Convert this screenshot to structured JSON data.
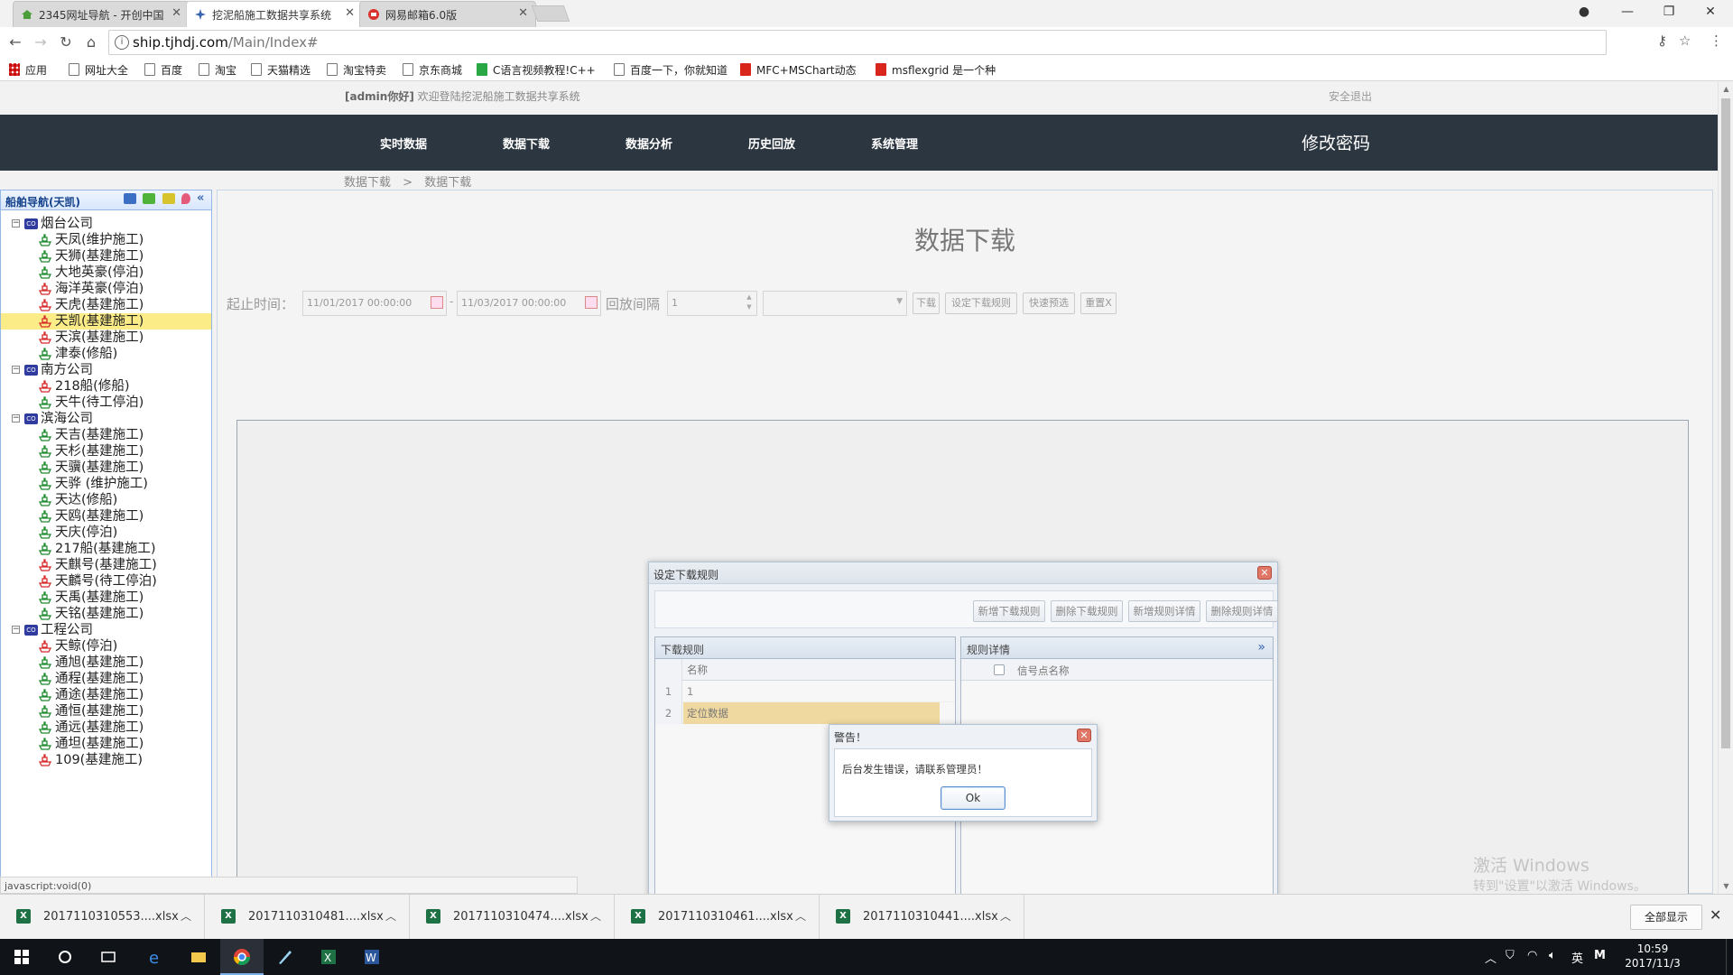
{
  "browser": {
    "tabs": [
      {
        "label": "2345网址导航 - 开创中国",
        "active": false
      },
      {
        "label": "挖泥船施工数据共享系统",
        "active": true
      },
      {
        "label": "网易邮箱6.0版",
        "active": false
      }
    ],
    "url_host": "ship.tjhdj.com",
    "url_path": "/Main/Index#",
    "bookmarks": [
      "应用",
      "网址大全",
      "百度",
      "淘宝",
      "天猫精选",
      "淘宝特卖",
      "京东商城",
      "C语言视频教程!C++",
      "百度一下，你就知道",
      "MFC+MSChart动态",
      "msflexgrid 是一个种"
    ]
  },
  "header": {
    "user": "[admin你好]",
    "welcome": "欢迎登陆挖泥船施工数据共享系统",
    "logout": "安全退出",
    "nav": [
      "实时数据",
      "数据下载",
      "数据分析",
      "历史回放",
      "系统管理"
    ],
    "change_password": "修改密码"
  },
  "breadcrumb": {
    "parent": "数据下载",
    "sep": ">",
    "current": "数据下载"
  },
  "left_panel": {
    "title": "船舶导航(天凯)",
    "tree": [
      {
        "type": "company",
        "label": "烟台公司"
      },
      {
        "type": "ship",
        "label": "天凤(维护施工)",
        "status": "green"
      },
      {
        "type": "ship",
        "label": "天狮(基建施工)",
        "status": "green"
      },
      {
        "type": "ship",
        "label": "大地英豪(停泊)",
        "status": "green"
      },
      {
        "type": "ship",
        "label": "海洋英豪(停泊)",
        "status": "red"
      },
      {
        "type": "ship",
        "label": "天虎(基建施工)",
        "status": "red"
      },
      {
        "type": "ship",
        "label": "天凯(基建施工)",
        "status": "red",
        "selected": true
      },
      {
        "type": "ship",
        "label": "天滨(基建施工)",
        "status": "red"
      },
      {
        "type": "ship",
        "label": "津泰(修船)",
        "status": "green"
      },
      {
        "type": "company",
        "label": "南方公司"
      },
      {
        "type": "ship",
        "label": "218船(修船)",
        "status": "red"
      },
      {
        "type": "ship",
        "label": "天牛(待工停泊)",
        "status": "green"
      },
      {
        "type": "company",
        "label": "滨海公司"
      },
      {
        "type": "ship",
        "label": "天吉(基建施工)",
        "status": "green"
      },
      {
        "type": "ship",
        "label": "天杉(基建施工)",
        "status": "green"
      },
      {
        "type": "ship",
        "label": "天骥(基建施工)",
        "status": "green"
      },
      {
        "type": "ship",
        "label": "天骅 (维护施工)",
        "status": "green"
      },
      {
        "type": "ship",
        "label": "天达(修船)",
        "status": "green"
      },
      {
        "type": "ship",
        "label": "天鸥(基建施工)",
        "status": "green"
      },
      {
        "type": "ship",
        "label": "天庆(停泊)",
        "status": "green"
      },
      {
        "type": "ship",
        "label": "217船(基建施工)",
        "status": "green"
      },
      {
        "type": "ship",
        "label": "天麒号(基建施工)",
        "status": "red"
      },
      {
        "type": "ship",
        "label": "天麟号(待工停泊)",
        "status": "red"
      },
      {
        "type": "ship",
        "label": "天禹(基建施工)",
        "status": "green"
      },
      {
        "type": "ship",
        "label": "天铭(基建施工)",
        "status": "green"
      },
      {
        "type": "company",
        "label": "工程公司"
      },
      {
        "type": "ship",
        "label": "天鲸(停泊)",
        "status": "red"
      },
      {
        "type": "ship",
        "label": "通旭(基建施工)",
        "status": "green"
      },
      {
        "type": "ship",
        "label": "通程(基建施工)",
        "status": "green"
      },
      {
        "type": "ship",
        "label": "通途(基建施工)",
        "status": "green"
      },
      {
        "type": "ship",
        "label": "通恒(基建施工)",
        "status": "green"
      },
      {
        "type": "ship",
        "label": "通远(基建施工)",
        "status": "green"
      },
      {
        "type": "ship",
        "label": "通坦(基建施工)",
        "status": "green"
      },
      {
        "type": "ship",
        "label": "109(基建施工)",
        "status": "red"
      }
    ]
  },
  "content": {
    "title": "数据下载",
    "filter": {
      "start_label": "起止时间：",
      "start_value": "11/01/2017 00:00:00",
      "dash": "-",
      "end_value": "11/03/2017 00:00:00",
      "interval_label": "回放间隔",
      "interval_value": "1",
      "buttons": [
        "下载",
        "设定下载规则",
        "快速预选",
        "重置X"
      ]
    }
  },
  "dialog": {
    "title": "设定下载规则",
    "toolbar": [
      "新增下载规则",
      "删除下载规则",
      "新增规则详情",
      "删除规则详情"
    ],
    "left_pane": {
      "title": "下载规则",
      "col": "名称",
      "rows": [
        {
          "n": "1",
          "name": "1"
        },
        {
          "n": "2",
          "name": "定位数据"
        }
      ]
    },
    "right_pane": {
      "title": "规则详情",
      "col": "信号点名称",
      "collapse": "»"
    }
  },
  "alert": {
    "title": "警告！",
    "message": "后台发生错误，请联系管理员！",
    "ok": "Ok"
  },
  "statusbar": "javascript:void(0)",
  "watermark": {
    "line1": "激活 Windows",
    "line2": "转到\"设置\"以激活 Windows。"
  },
  "downloads": {
    "files": [
      "2017110310553....xlsx",
      "2017110310481....xlsx",
      "2017110310474....xlsx",
      "2017110310461....xlsx",
      "2017110310441....xlsx"
    ],
    "show_all": "全部显示"
  },
  "taskbar": {
    "ime": "英",
    "time": "10:59",
    "date": "2017/11/3"
  },
  "colors": {
    "nav_bg": "#2c3640",
    "ship_green": "#1e8b2e",
    "ship_red": "#d62b2b",
    "selected_row": "#fbec88",
    "company_icon": "#2f3b9e"
  }
}
